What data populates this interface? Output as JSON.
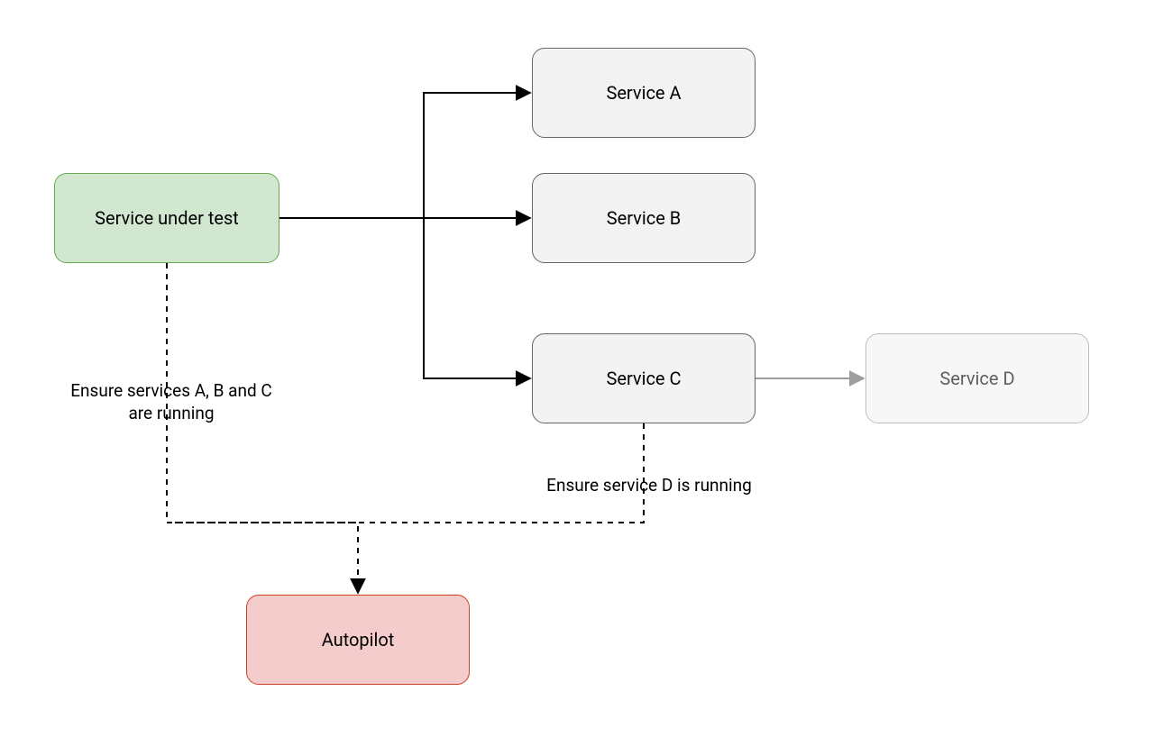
{
  "nodes": {
    "service_under_test": "Service under test",
    "service_a": "Service A",
    "service_b": "Service B",
    "service_c": "Service C",
    "service_d": "Service D",
    "autopilot": "Autopilot"
  },
  "labels": {
    "ensure_abc": "Ensure services A, B and C\nare running",
    "ensure_d": "Ensure service D is running"
  },
  "colors": {
    "green_fill": "#d1e7d0",
    "green_border": "#6aa84f",
    "gray_fill": "#f3f3f3",
    "gray_border": "#666666",
    "lightgray_fill": "#f7f7f7",
    "lightgray_border": "#bdbdbd",
    "pink_fill": "#f4cccc",
    "pink_border": "#cc4125",
    "edge_black": "#000000",
    "edge_gray": "#9e9e9e"
  }
}
